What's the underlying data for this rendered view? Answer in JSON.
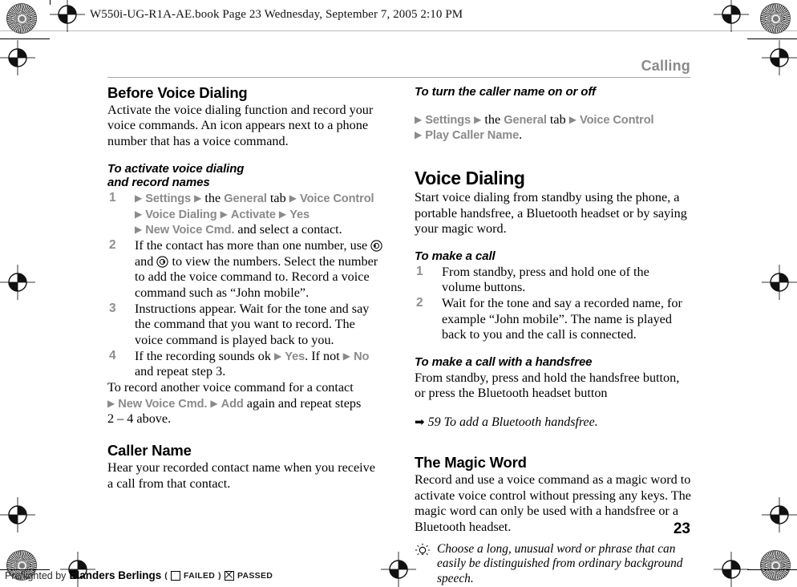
{
  "proof": {
    "slug": "W550i-UG-R1A-AE.book  Page 23  Wednesday, September 7, 2005  2:10 PM",
    "footer": {
      "prefix": "Preflighted by",
      "brand": "Elanders Berlings",
      "open_paren": "(",
      "failed_label": "FAILED",
      "close_paren": ")",
      "passed_label": "PASSED"
    },
    "marks": {
      "star_icon": "registration-starburst-icon",
      "cross_icon": "registration-crosshair-icon"
    }
  },
  "page": {
    "running_head": "Calling",
    "folio": "23"
  },
  "left_column": {
    "before_voice_dialing": {
      "heading": "Before Voice Dialing",
      "body": "Activate the voice dialing function and record your voice commands. An icon appears next to a phone number that has a voice command."
    },
    "activate_procedure": {
      "heading_line1": "To activate voice dialing",
      "heading_line2": "and record names",
      "steps": [
        {
          "num": "1",
          "nav": [
            {
              "arrow": "▶",
              "ui": "Settings"
            },
            {
              "arrow": "▶",
              "plain_before": "the ",
              "ui": "General",
              "plain_after": " tab"
            },
            {
              "arrow": "▶",
              "ui": "Voice Control"
            },
            {
              "arrow": "▶",
              "ui": "Voice Dialing"
            },
            {
              "arrow": "▶",
              "ui": "Activate"
            },
            {
              "arrow": "▶",
              "ui": "Yes"
            },
            {
              "arrow": "▶",
              "ui": "New Voice Cmd.",
              "plain_after": " and select a contact."
            }
          ]
        },
        {
          "num": "2",
          "text_a": "If the contact has more than one number, use ",
          "key_left": "nav-key-left-icon",
          "text_b": " and ",
          "key_right": "nav-key-right-icon",
          "text_c": " to view the numbers. Select the number to add the voice command to. Record a voice command such as “John mobile”."
        },
        {
          "num": "3",
          "text": "Instructions appear. Wait for the tone and say the command that you want to record. The voice command is played back to you."
        },
        {
          "num": "4",
          "text_a": "If the recording sounds ok ",
          "ui_yes": "Yes",
          "text_b": ". If not ",
          "ui_no": "No",
          "text_c": " and repeat step 3."
        }
      ],
      "trailer": {
        "line1": "To record another voice command for a contact",
        "ui_new_voice_cmd": "New Voice Cmd.",
        "ui_add": "Add",
        "tail": " again and repeat steps",
        "line3": "2 – 4 above."
      }
    },
    "caller_name": {
      "heading": "Caller Name",
      "body": "Hear your recorded contact name when you receive a call from that contact."
    }
  },
  "right_column": {
    "caller_name_toggle": {
      "heading": "To turn the caller name on or off",
      "nav": [
        {
          "arrow": "▶",
          "ui": "Settings"
        },
        {
          "arrow": "▶",
          "plain_before": "the ",
          "ui": "General",
          "plain_after": " tab"
        },
        {
          "arrow": "▶",
          "ui": "Voice Control"
        },
        {
          "arrow": "▶",
          "ui": "Play Caller Name",
          "plain_after": "."
        }
      ]
    },
    "voice_dialing": {
      "heading": "Voice Dialing",
      "body": "Start voice dialing from standby using the phone, a portable handsfree, a Bluetooth headset or by saying your magic word."
    },
    "make_a_call": {
      "heading": "To make a call",
      "steps": [
        {
          "num": "1",
          "text": "From standby, press and hold one of the volume buttons."
        },
        {
          "num": "2",
          "text": "Wait for the tone and say a recorded name, for example “John mobile”. The name is played back to you and the call is connected."
        }
      ]
    },
    "handsfree_call": {
      "heading": "To make a call with a handsfree",
      "body": "From standby, press and hold the handsfree button, or press the Bluetooth headset button",
      "xref_arrow": "➡",
      "xref_text": "59 To add a Bluetooth handsfree."
    },
    "magic_word": {
      "heading": "The Magic Word",
      "body": "Record and use a voice command as a magic word to activate voice control without pressing any keys. The magic word can only be used with a handsfree or a Bluetooth headset.",
      "tip_icon": "lightbulb-tip-icon",
      "tip": "Choose a long, unusual word or phrase that can easily be distinguished from ordinary background speech."
    }
  },
  "colors": {
    "ui_gray": "#8a8a8a",
    "head_gray": "#8a8a8a",
    "text_black": "#000000"
  }
}
